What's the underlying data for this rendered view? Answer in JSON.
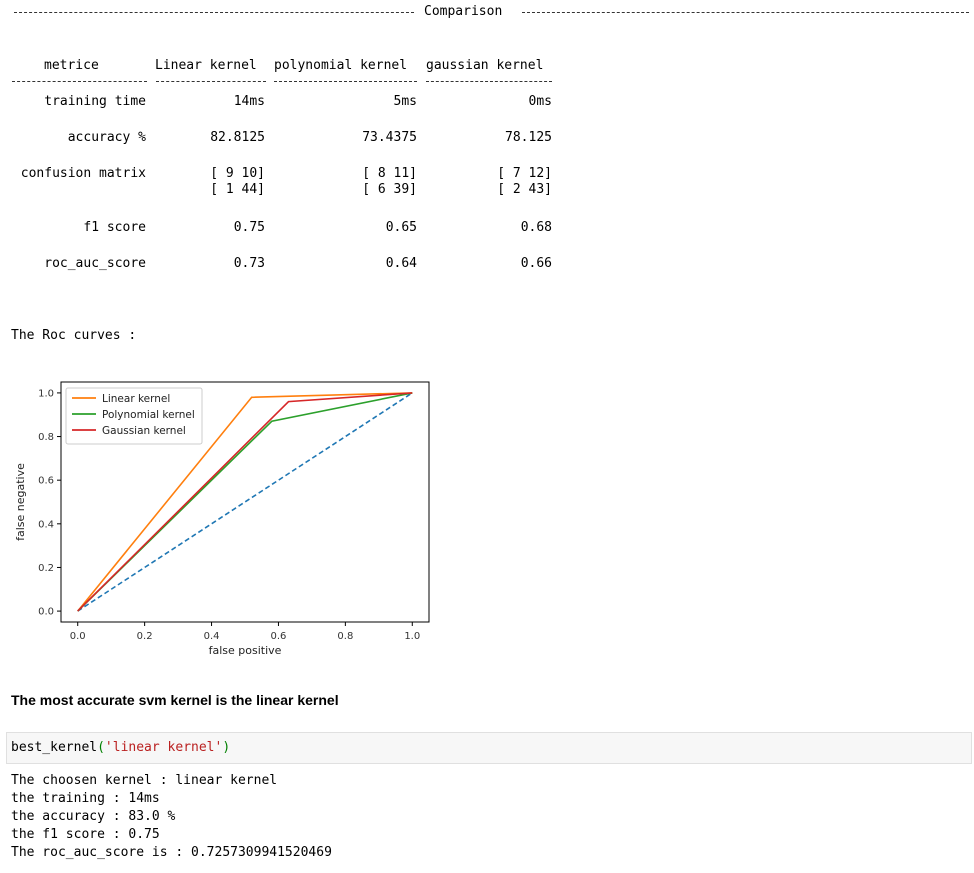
{
  "comparison": {
    "title": "Comparison",
    "columns": [
      "metrice",
      "Linear kernel",
      "polynomial kernel",
      "gaussian kernel"
    ],
    "rows": [
      {
        "metric": "training time",
        "values": [
          "14ms",
          "5ms",
          "0ms"
        ]
      },
      {
        "metric": "accuracy %",
        "values": [
          "82.8125",
          "73.4375",
          "78.125"
        ]
      },
      {
        "metric": "confusion matrix",
        "values": [
          [
            "[ 9 10]",
            "[ 1 44]"
          ],
          [
            "[ 8 11]",
            "[ 6 39]"
          ],
          [
            "[ 7 12]",
            "[ 2 43]"
          ]
        ]
      },
      {
        "metric": "f1 score",
        "values": [
          "0.75",
          "0.65",
          "0.68"
        ]
      },
      {
        "metric": "roc_auc_score",
        "values": [
          "0.73",
          "0.64",
          "0.66"
        ]
      }
    ]
  },
  "roc_heading": "The Roc curves :",
  "chart_data": {
    "type": "line",
    "xlabel": "false positive",
    "ylabel": "false negative",
    "xlim": [
      -0.05,
      1.05
    ],
    "ylim": [
      -0.05,
      1.05
    ],
    "xticks": [
      "0.0",
      "0.2",
      "0.4",
      "0.6",
      "0.8",
      "1.0"
    ],
    "yticks": [
      "0.0",
      "0.2",
      "0.4",
      "0.6",
      "0.8",
      "1.0"
    ],
    "legend_position": "top-left",
    "grid": false,
    "series": [
      {
        "name": "Linear kernel",
        "color": "#ff7f0e",
        "x": [
          0.0,
          0.52,
          1.0
        ],
        "y": [
          0.0,
          0.98,
          1.0
        ]
      },
      {
        "name": "Polynomial kernel",
        "color": "#2ca02c",
        "x": [
          0.0,
          0.58,
          1.0
        ],
        "y": [
          0.0,
          0.87,
          1.0
        ]
      },
      {
        "name": "Gaussian kernel",
        "color": "#d62728",
        "x": [
          0.0,
          0.63,
          1.0
        ],
        "y": [
          0.0,
          0.96,
          1.0
        ]
      },
      {
        "color": "#1f77b4",
        "dashed": true,
        "x": [
          0.0,
          1.0
        ],
        "y": [
          0.0,
          1.0
        ]
      }
    ]
  },
  "conclusion": "The most accurate svm kernel is the linear kernel",
  "code": {
    "func": "best_kernel",
    "open": "(",
    "arg": "'linear kernel'",
    "close": ")"
  },
  "output_lines": [
    "The choosen kernel : linear kernel",
    "the training : 14ms",
    "the accuracy : 83.0 %",
    "the f1 score : 0.75",
    "The roc_auc_score is : 0.7257309941520469"
  ]
}
